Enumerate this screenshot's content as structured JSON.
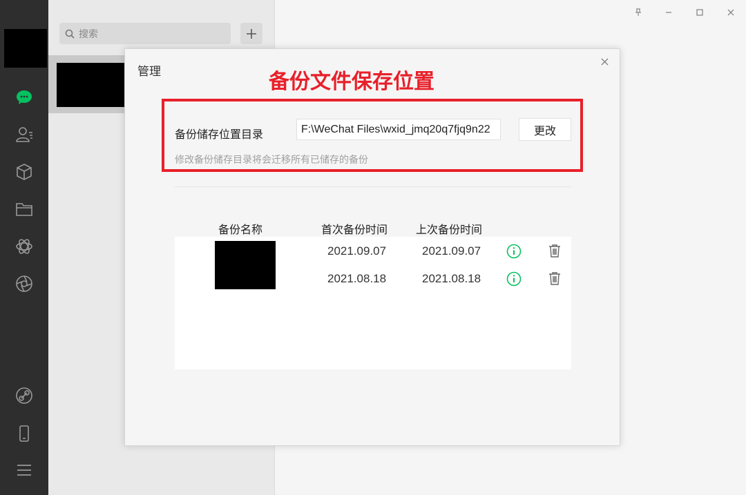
{
  "sidebar": {
    "icons": [
      "chat-icon",
      "contacts-icon",
      "favorites-icon",
      "files-icon",
      "miniprogram-icon",
      "moments-icon",
      "link-icon",
      "phone-icon",
      "menu-icon"
    ]
  },
  "search": {
    "placeholder": "搜索"
  },
  "dialog": {
    "title": "管理",
    "annotation": "备份文件保存位置",
    "storage_label": "备份储存位置目录",
    "storage_path": "F:\\WeChat Files\\wxid_jmq20q7fjq9n22",
    "change_button": "更改",
    "hint": "修改备份储存目录将会迁移所有已储存的备份",
    "columns": {
      "name": "备份名称",
      "first_time": "首次备份时间",
      "last_time": "上次备份时间"
    },
    "rows": [
      {
        "first": "2021.09.07",
        "last": "2021.09.07"
      },
      {
        "first": "2021.08.18",
        "last": "2021.08.18"
      }
    ]
  },
  "colors": {
    "accent_green": "#07c160",
    "annotation_red": "#e8202a",
    "nav_bg": "#2e2e2e"
  }
}
